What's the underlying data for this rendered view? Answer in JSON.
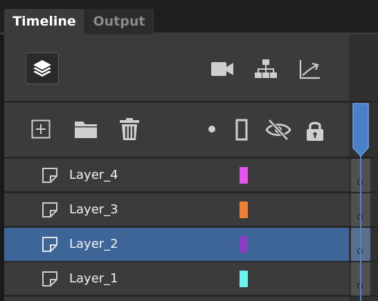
{
  "tabs": [
    {
      "label": "Timeline",
      "active": true
    },
    {
      "label": "Output",
      "active": false
    }
  ],
  "toolbar_top": {
    "layers_icon": "layers-icon",
    "camera_icon": "video-camera-icon",
    "hierarchy_icon": "hierarchy-icon",
    "graph_icon": "graph-editor-icon"
  },
  "toolbar_layers": {
    "add_icon": "add-layer-icon",
    "folder_icon": "folder-icon",
    "trash_icon": "trash-icon",
    "dot_icon": "dot-icon",
    "outline_icon": "outline-icon",
    "visibility_icon": "eye-hidden-icon",
    "lock_icon": "lock-icon"
  },
  "layers": [
    {
      "name": "Layer_4",
      "color": "#e455ee",
      "selected": false
    },
    {
      "name": "Layer_3",
      "color": "#ee7f34",
      "selected": false
    },
    {
      "name": "Layer_2",
      "color": "#8a3ec4",
      "selected": true
    },
    {
      "name": "Layer_1",
      "color": "#6ef4f0",
      "selected": false
    }
  ],
  "colors": {
    "selection": "#3e6597",
    "playhead": "#4c86d8"
  }
}
